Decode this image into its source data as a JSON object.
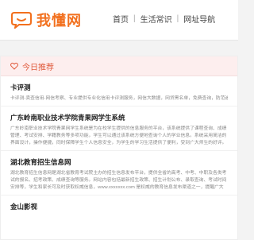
{
  "brand": {
    "name": "我懂网",
    "color": "#f2701e"
  },
  "nav": {
    "items": [
      "首页",
      "生活常识",
      "网址导航"
    ],
    "separator": "|"
  },
  "section": {
    "label": "今日推荐",
    "icon": "heart-icon"
  },
  "articles": [
    {
      "title": "卡评测",
      "desc": "卡评测-卖查信用-网信考察、专业提供专业化信用卡评测服务，网信大数据，网贷黑名单，免费查询，防范逾期记录等查询服务。。卡评测..."
    },
    {
      "title": "广东岭南职业技术学院青果网学生系统",
      "desc": "广东岭南职业技术学院青果网学生系统是为在校学生提供的信息服务的平台，该系统提供了课程查询、成绩管理、考试安排、学籍教务等多项功能，学生可以通过该系统方便地查询个人的学业信息。系统采用简洁的界面设计，操作便捷，同时保障学生个人信息安全，为学生的学习生活提供了便利，受到广大师生的好评。广东岭南职业技术学院以服务学生为中心..."
    },
    {
      "title": "湖北教育招生信息网",
      "desc": "湖北教育招生信息网是湖北省教育考试院主办的招生信息发布平台，提供全省的高考、中考、中职及各类考试的报名、招考政策、成绩查询等服务。网站内容包括最新招生政策、招生计划公布、录取查询、考试时间安排等，学生和家长可及时获取权威信息，www.xxxxxxx.com 是权威的教育信息发布渠道之一，提醒广大考生注意甄别..."
    },
    {
      "title": "金山影视",
      "desc": ""
    }
  ]
}
